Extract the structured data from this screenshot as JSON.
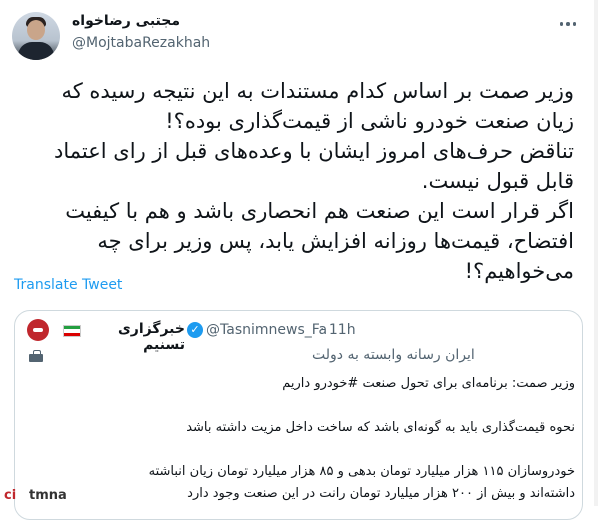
{
  "author": {
    "display_name": "مجتبی رضاخواه",
    "handle": "@MojtabaRezakhah"
  },
  "tweet_lines": [
    "وزیر صمت بر اساس کدام مستندات به این نتیجه رسیده که",
    "زیان صنعت خودرو ناشی از قیمت‌گذاری بوده؟!",
    "تناقض حرف‌های امروز ایشان با وعده‌های قبل از رای اعتماد",
    "قابل قبول نیست.",
    "اگر قرار است این صنعت هم انحصاری باشد و هم با کیفیت",
    "افتضاح، قیمت‌ها روزانه افزایش یابد، پس وزیر برای چه",
    "می‌خواهیم؟!"
  ],
  "translate_label": "Translate Tweet",
  "quoted": {
    "name": "خبرگزاری تسنیم",
    "verified_glyph": "✓",
    "handle": "@Tasnimnews_Fa",
    "time": "· 11h",
    "bio": "ایران رسانه وابسته به دولت",
    "body_lines": [
      "وزیر صمت: برنامه‌ای برای تحول صنعت #خودرو داریم",
      "",
      "نحوه قیمت‌گذاری باید به گونه‌ای باشد که ساخت داخل مزیت داشته باشد",
      "",
      "خودروسازان ۱۱۵ هزار میلیارد تومان بدهی و ۸۵ هزار میلیارد تومان زیان انباشته",
      "داشته‌اند و بیش از ۲۰۰ هزار میلیارد تومان رانت در این صنعت وجود دارد"
    ]
  },
  "watermark": {
    "part1": "ci",
    "part2": "tmna"
  },
  "colors": {
    "link": "#1d9bf0",
    "muted": "#536471",
    "text": "#0f1419",
    "border": "#cfd9de"
  }
}
